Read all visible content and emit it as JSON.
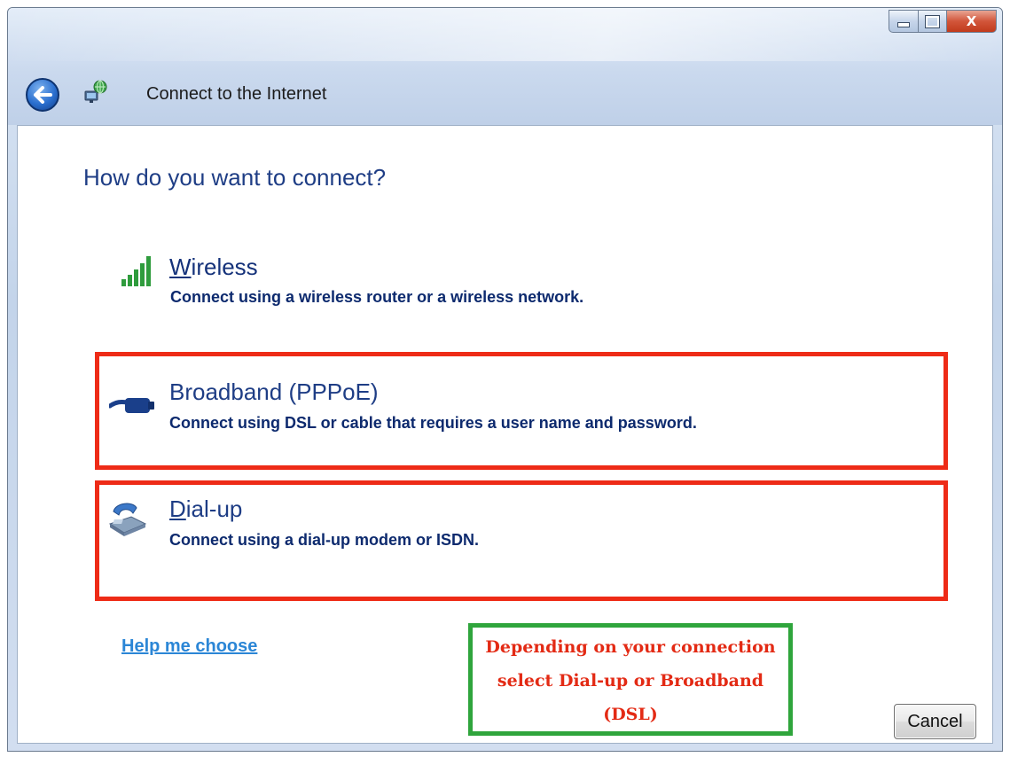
{
  "window": {
    "title": "Connect to the Internet",
    "close_label": "X"
  },
  "page": {
    "heading": "How do you want to connect?"
  },
  "options": [
    {
      "title": "Wireless",
      "description": "Connect using a wireless router or a wireless network.",
      "icon": "signal-bars-icon"
    },
    {
      "title": "Broadband (PPPoE)",
      "description": "Connect using DSL or cable that requires a user name and password.",
      "icon": "network-cable-icon",
      "highlighted": true
    },
    {
      "title": "Dial-up",
      "description": "Connect using a dial-up modem or ISDN.",
      "icon": "telephone-modem-icon",
      "highlighted": true
    }
  ],
  "help_link": "Help me choose",
  "annotation": {
    "line1": "Depending on your connection",
    "line2": "select Dial-up or Broadband",
    "line3": "(DSL)"
  },
  "buttons": {
    "cancel": "Cancel"
  },
  "colors": {
    "highlight_border": "#ee2b17",
    "annotation_border": "#2fa53c",
    "annotation_text": "#e32a14",
    "heading_text": "#1e3d85",
    "link": "#2b86d6"
  }
}
